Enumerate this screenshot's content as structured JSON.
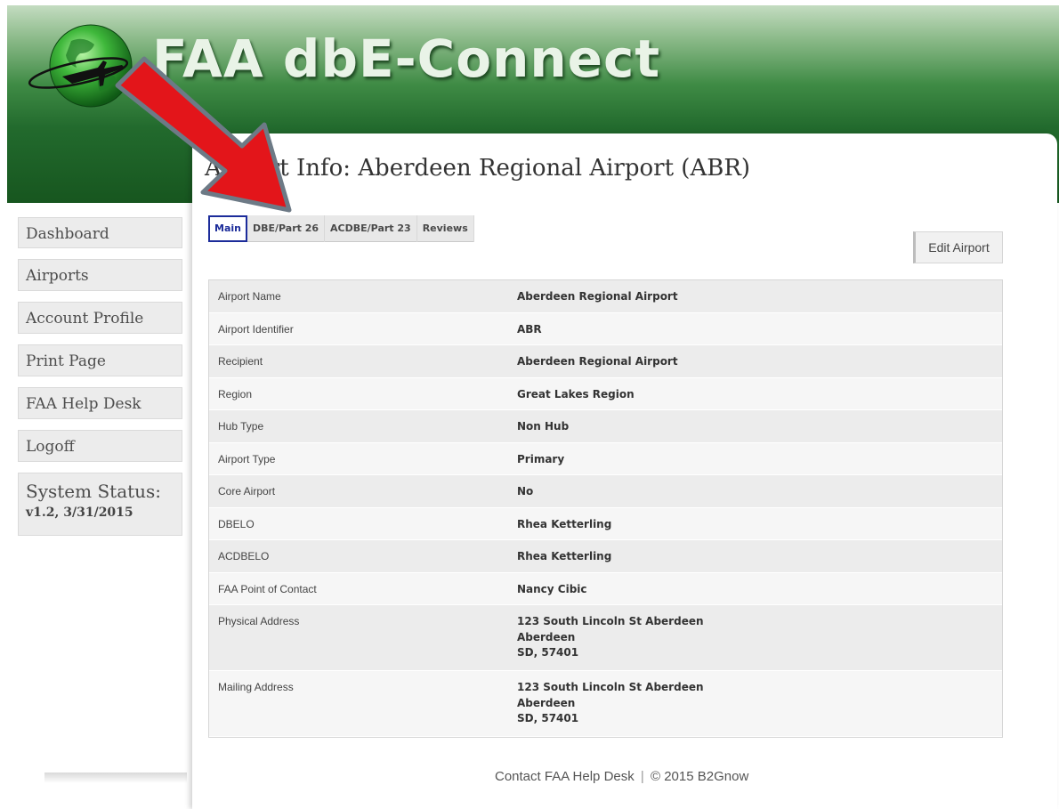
{
  "header": {
    "app_title": "FAA dbE-Connect",
    "colors": {
      "banner_top": "#c4dcc1",
      "banner_bottom": "#17561f",
      "title_text": "#e9f3e7"
    }
  },
  "page": {
    "title": "Airport Info: Aberdeen Regional Airport (ABR)"
  },
  "tabs": [
    {
      "label": "Main",
      "active": true
    },
    {
      "label": "DBE/Part 26",
      "active": false
    },
    {
      "label": "ACDBE/Part 23",
      "active": false
    },
    {
      "label": "Reviews",
      "active": false
    }
  ],
  "actions": {
    "edit_airport": "Edit Airport"
  },
  "details": [
    {
      "label": "Airport Name",
      "value": [
        "Aberdeen Regional Airport"
      ]
    },
    {
      "label": "Airport Identifier",
      "value": [
        "ABR"
      ]
    },
    {
      "label": "Recipient",
      "value": [
        "Aberdeen Regional Airport"
      ]
    },
    {
      "label": "Region",
      "value": [
        "Great Lakes Region"
      ]
    },
    {
      "label": "Hub Type",
      "value": [
        "Non Hub"
      ]
    },
    {
      "label": "Airport Type",
      "value": [
        "Primary"
      ]
    },
    {
      "label": "Core Airport",
      "value": [
        "No"
      ]
    },
    {
      "label": "DBELO",
      "value": [
        "Rhea Ketterling"
      ]
    },
    {
      "label": "ACDBELO",
      "value": [
        "Rhea Ketterling"
      ]
    },
    {
      "label": "FAA Point of Contact",
      "value": [
        "Nancy Cibic"
      ]
    },
    {
      "label": "Physical Address",
      "value": [
        "123 South Lincoln St Aberdeen",
        "Aberdeen",
        "SD, 57401"
      ]
    },
    {
      "label": "Mailing Address",
      "value": [
        "123 South Lincoln St Aberdeen",
        "Aberdeen",
        "SD, 57401"
      ]
    }
  ],
  "sidebar": {
    "items": [
      {
        "label": "Dashboard"
      },
      {
        "label": "Airports"
      },
      {
        "label": "Account Profile"
      },
      {
        "label": "Print Page"
      },
      {
        "label": "FAA Help Desk"
      },
      {
        "label": "Logoff"
      }
    ],
    "status_title": "System Status:",
    "status_version": "v1.2, 3/31/2015"
  },
  "footer": {
    "contact_link": "Contact FAA Help Desk",
    "separator": "|",
    "copyright": "© 2015 B2Gnow"
  },
  "annotation": {
    "arrow_color": "#e3151a",
    "arrow_icon": "red-arrow-icon"
  }
}
